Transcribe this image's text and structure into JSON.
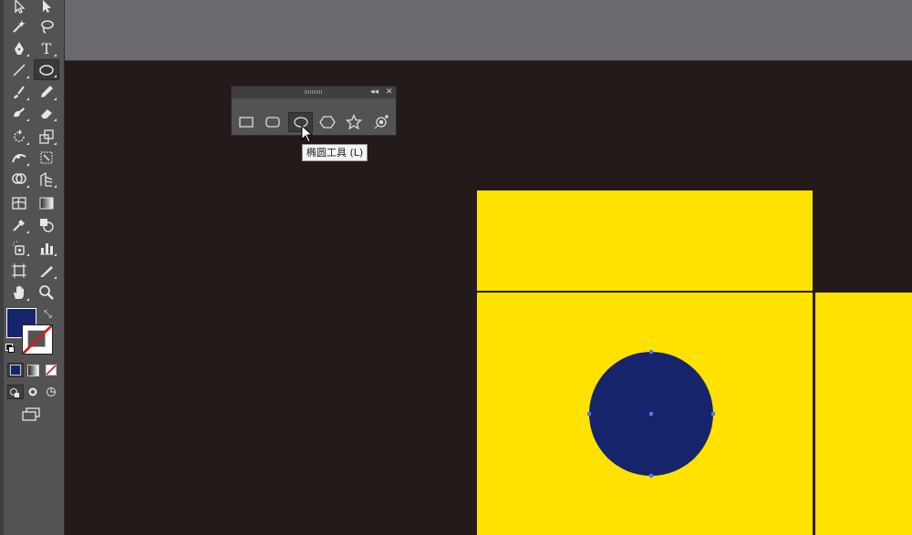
{
  "toolbar": {
    "type_tool_glyph": "T",
    "fill_color": "#16246b",
    "stroke": "none"
  },
  "shape_panel": {
    "collapse_glyph": "◂◂",
    "close_glyph": "✕",
    "tools": [
      {
        "name": "rectangle-tool-icon"
      },
      {
        "name": "rounded-rectangle-tool-icon"
      },
      {
        "name": "ellipse-tool-icon",
        "active": true
      },
      {
        "name": "polygon-tool-icon"
      },
      {
        "name": "star-tool-icon"
      },
      {
        "name": "flare-tool-icon"
      }
    ],
    "tooltip": "椭圆工具 (L)"
  },
  "artwork": {
    "yellow": "#ffe200",
    "navy": "#16246b",
    "selection": "#4a7cf7"
  }
}
